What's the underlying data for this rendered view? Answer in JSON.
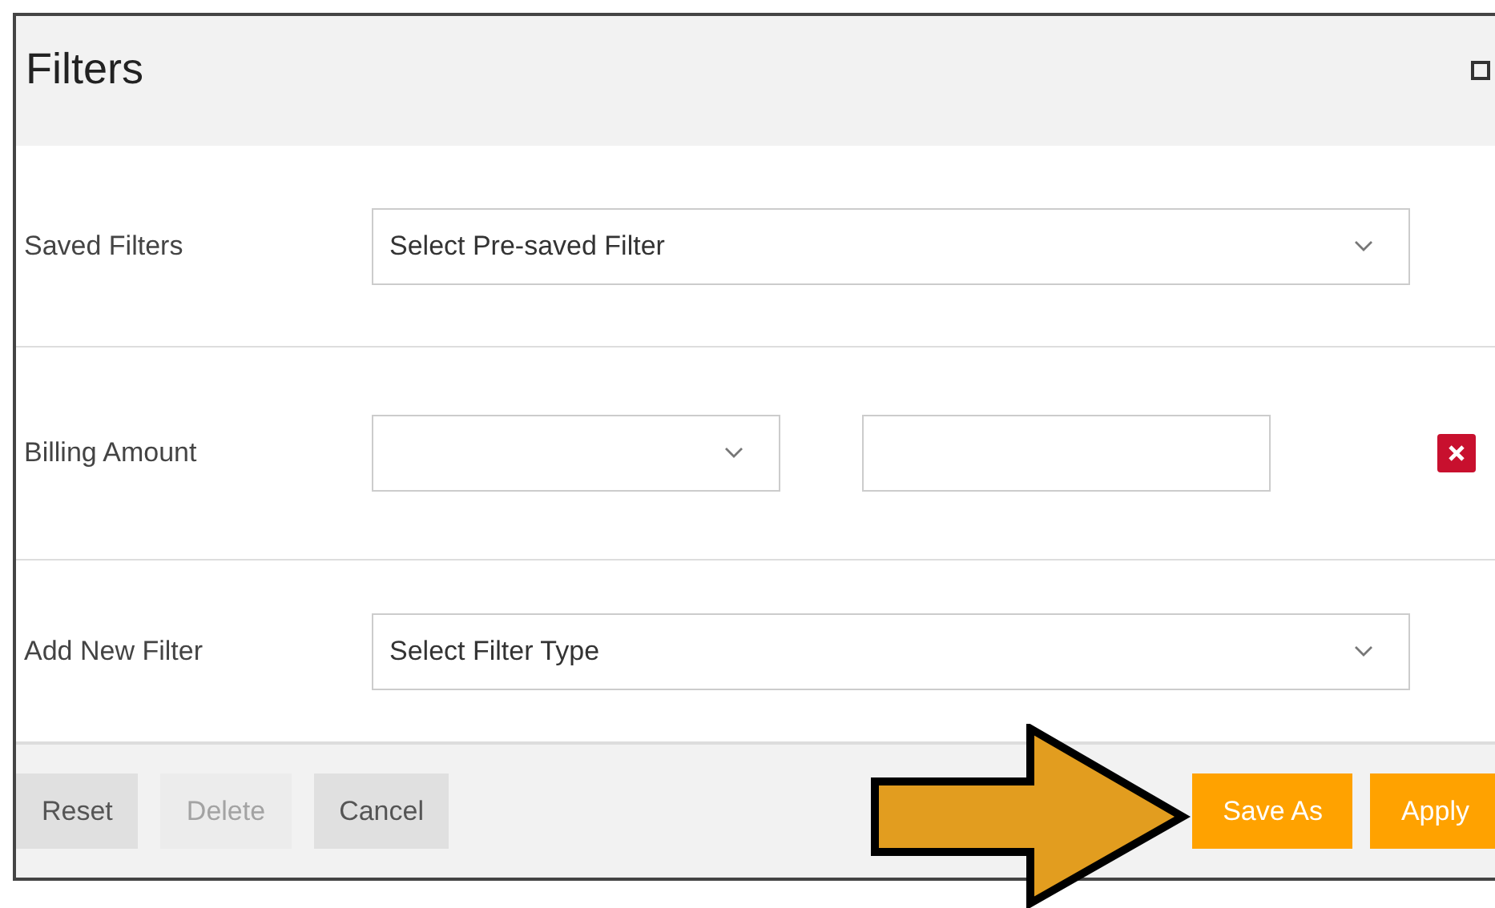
{
  "window": {
    "title": "Filters"
  },
  "rows": [
    {
      "kind": "select",
      "label": "Saved Filters",
      "placeholder": "Select Pre-saved Filter"
    },
    {
      "kind": "range",
      "label": "Billing Amount",
      "removable": true
    },
    {
      "kind": "select",
      "label": "Add New Filter",
      "placeholder": "Select Filter Type"
    }
  ],
  "buttons": [
    {
      "label": "Reset",
      "kind": "secondary",
      "disabled": false
    },
    {
      "label": "Delete",
      "kind": "secondary",
      "disabled": true
    },
    {
      "label": "Cancel",
      "kind": "secondary",
      "disabled": false
    },
    {
      "label": "Save As",
      "kind": "primary",
      "disabled": false
    },
    {
      "label": "Apply",
      "kind": "primary",
      "disabled": false
    }
  ]
}
